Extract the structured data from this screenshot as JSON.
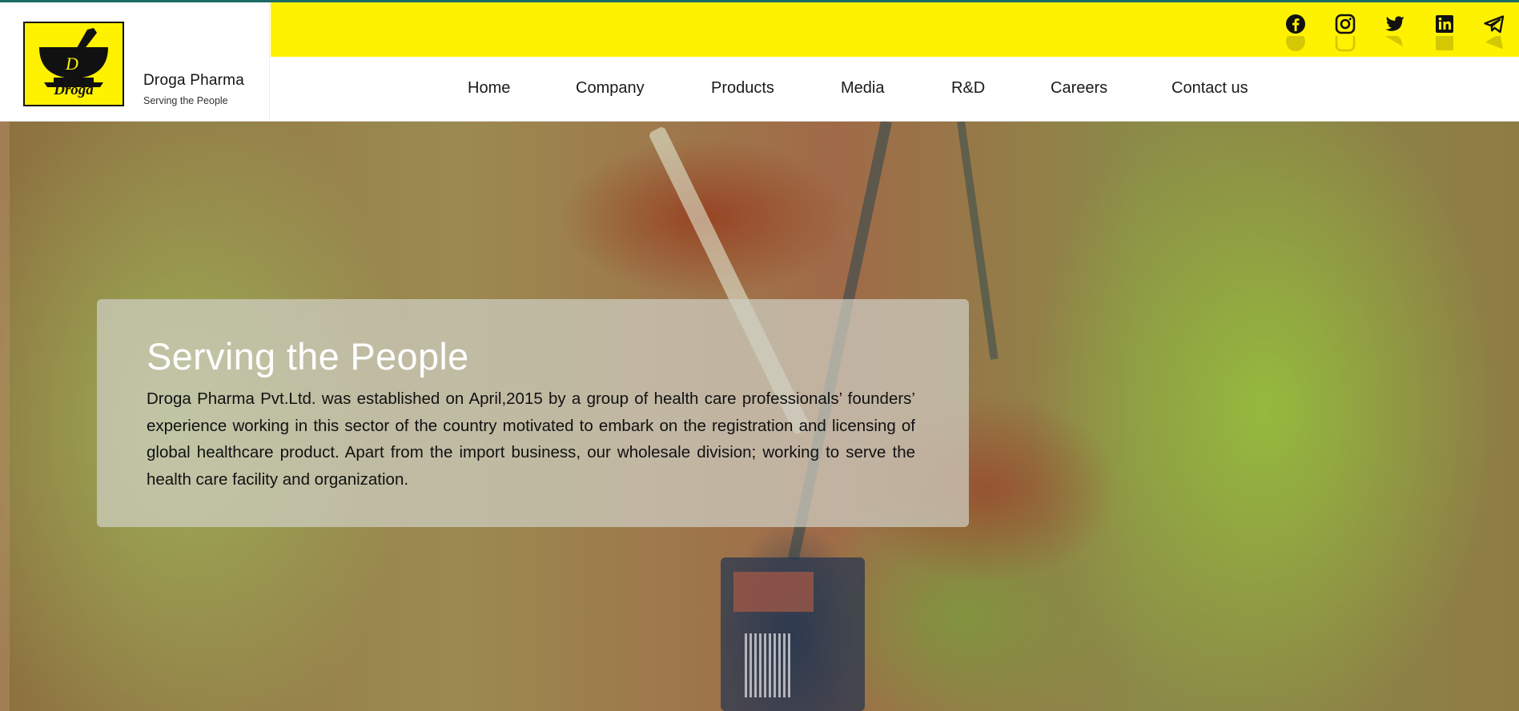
{
  "brand": {
    "logo_word": "Droga",
    "logo_letter": "D",
    "name": "Droga Pharma",
    "tagline": "Serving the People",
    "accent_color": "#fff200"
  },
  "social": [
    {
      "name": "facebook-icon"
    },
    {
      "name": "instagram-icon"
    },
    {
      "name": "twitter-icon"
    },
    {
      "name": "linkedin-icon"
    },
    {
      "name": "telegram-icon"
    }
  ],
  "nav": {
    "items": [
      "Home",
      "Company",
      "Products",
      "Media",
      "R&D",
      "Careers",
      "Contact us"
    ]
  },
  "hero": {
    "title": "Serving the People",
    "text": "Droga Pharma Pvt.Ltd. was established on April,2015 by a group of health care professionals’ founders’ experience working in this sector of the country motivated to embark on the registration and licensing of global healthcare product. Apart from the import business, our wholesale division; working to serve the health care facility and organization."
  }
}
